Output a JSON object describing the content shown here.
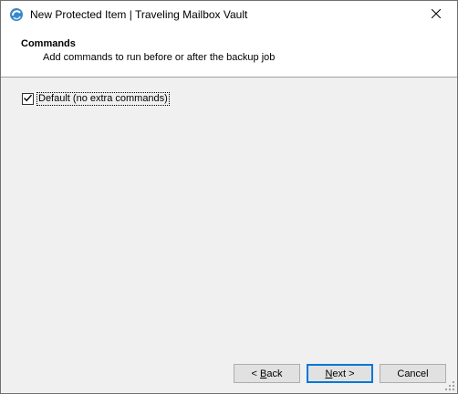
{
  "window": {
    "title": "New Protected Item | Traveling Mailbox Vault",
    "icon": "app-logo-icon",
    "close_icon": "close-icon"
  },
  "header": {
    "title": "Commands",
    "subtitle": "Add commands to run before or after the backup job"
  },
  "main": {
    "checkbox": {
      "label": "Default (no extra commands)",
      "checked": true
    }
  },
  "footer": {
    "back_prefix": "< ",
    "back_mnemonic": "B",
    "back_rest": "ack",
    "next_mnemonic": "N",
    "next_rest": "ext >",
    "cancel_label": "Cancel"
  },
  "colors": {
    "accent": "#0078d7",
    "dialog_bg": "#f0f0f0",
    "header_bg": "#ffffff"
  }
}
